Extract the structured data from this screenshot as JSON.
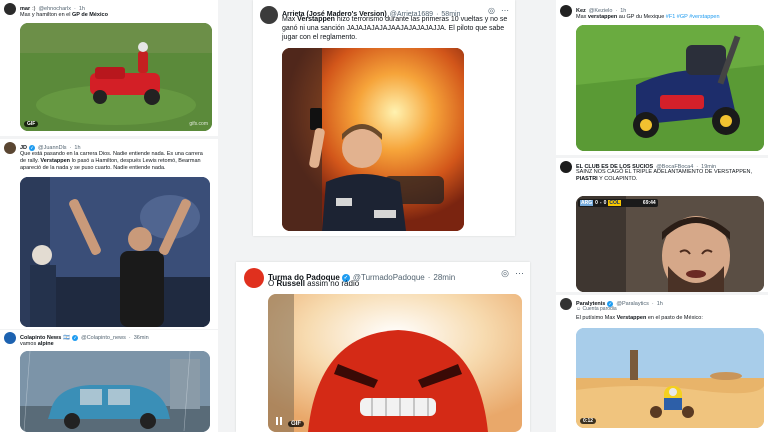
{
  "tweets": [
    {
      "name": "mar",
      "handle": "@ehnocharlx",
      "time": "1h",
      "text_plain_1": "Max y hamilton en el ",
      "text_bold_1": "GP de México",
      "media_badge": "GIF",
      "media_watermark": "gifs.com",
      "colors": {
        "avatar": "#2b2b2b"
      }
    },
    {
      "name": "JD",
      "handle": "@JuannDls",
      "time": "1h",
      "text_plain_1": "Que está pasando en la carrera Dios. Nadie entiende nada. Es una carrera de rally. ",
      "text_bold_1": "Verstappen",
      "text_plain_2": " lo pasó a Hamilton, después Lewis retomó, Bearman apareció de la nada y se puso cuarto. Nadie entiende nada.",
      "colors": {
        "avatar": "#5a4632"
      }
    },
    {
      "name": "Colapinto News",
      "flag": "🇦🇷",
      "handle": "@Colapinto_news",
      "time": "36min",
      "text_plain_1": "vamos ",
      "text_bold_1": "alpine",
      "colors": {
        "avatar": "#1d62b0"
      }
    },
    {
      "name": "Arrieta (José Madero's Version)",
      "handle": "@Arrieta1689",
      "time": "58min",
      "text_plain_1": "Max ",
      "text_bold_1": "Verstappen",
      "text_plain_2": " hizo terrorismo durante las primeras 10 vueltas y no se ganó ni una sanción JAJAJAJAJAJAAJAJAJAJAJJA. El piloto que sabe jugar con el reglamento.",
      "colors": {
        "avatar": "#3b3b3b"
      }
    },
    {
      "name": "Turma do Padoque",
      "handle": "@TurmadoPadoque",
      "time": "28min",
      "text_plain_1": "O ",
      "text_bold_1": "Russell",
      "text_plain_2": " assim no rádio",
      "media_badge": "GIF",
      "colors": {
        "avatar": "#e0301e"
      }
    },
    {
      "name": "Kez",
      "handle": "@Kezielo",
      "time": "1h",
      "text_plain_1": "Max ",
      "text_bold_1": "verstappen",
      "text_plain_2": " au GP du Mexique ",
      "hashtags": "#F1 #GP #verstappen",
      "colors": {
        "avatar": "#222222"
      }
    },
    {
      "name": "EL CLUB ES DE LOS SUCIOS",
      "handle": "@BocaFBoca4",
      "time": "19min",
      "text_plain_1": "SAINZ NOS CAGÓ EL TRIPLE ADELANTAMIENTO DE VERSTAPPEN, ",
      "text_bold_1": "PIASTRI",
      "text_plain_2": " Y COLAPINTO.",
      "scoreboard": {
        "left": "ARG",
        "score_a": "0",
        "score_b": "0",
        "right": "COL",
        "clock": "69:44"
      },
      "colors": {
        "avatar": "#1c1c1c"
      }
    },
    {
      "name": "Paralytenis",
      "handle": "@Paralaytics",
      "time": "1h",
      "parody_label": "Cuenta parodia",
      "text_plain_1": "El putísimo Max ",
      "text_bold_1": "Verstappen",
      "text_plain_2": " en el pasto de México:",
      "media_time": "0:12",
      "colors": {
        "avatar": "#333333"
      }
    }
  ],
  "ui": {
    "more_icon": "⋯",
    "grok_icon": "◎",
    "verified_mark": "✓",
    "parody_icon": "☺"
  }
}
